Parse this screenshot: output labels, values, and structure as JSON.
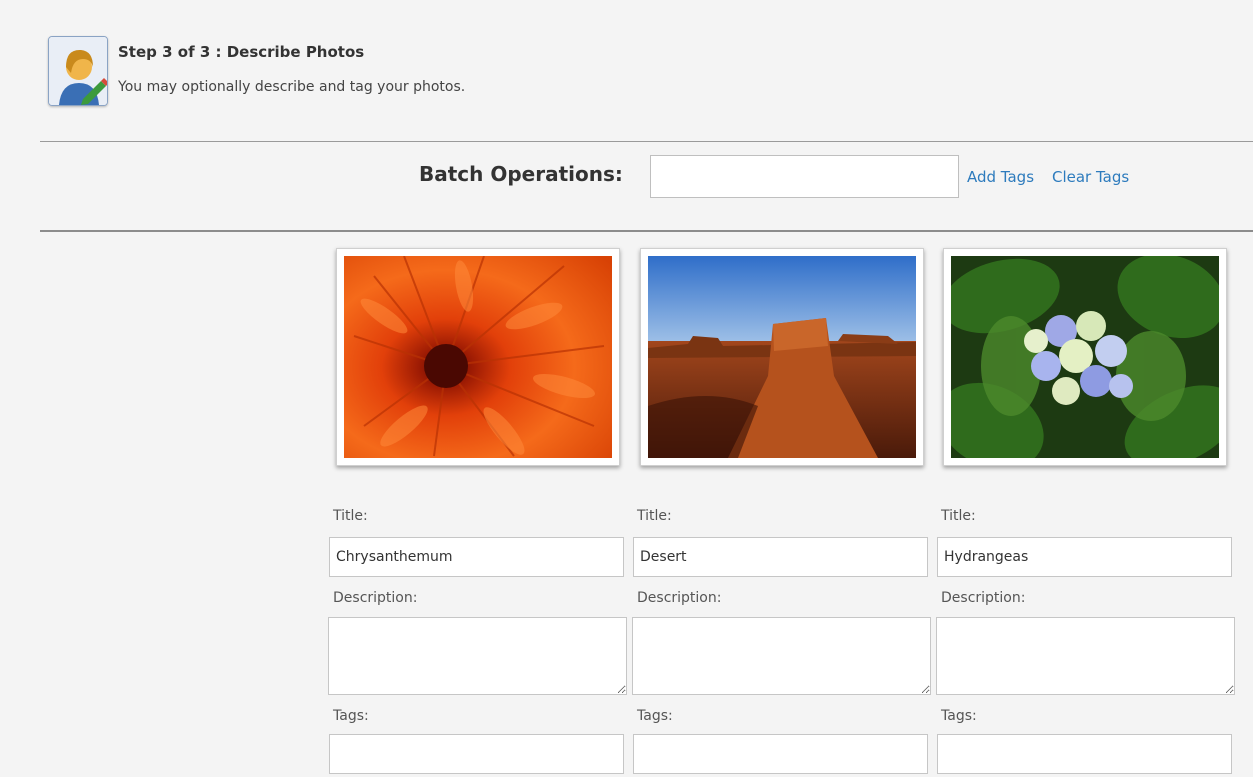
{
  "header": {
    "step_title": "Step 3 of 3 : Describe Photos",
    "step_subtitle": "You may optionally describe and tag your photos."
  },
  "batch": {
    "label": "Batch Operations:",
    "input_value": "",
    "add_tags_label": "Add Tags",
    "clear_tags_label": "Clear Tags"
  },
  "labels": {
    "title": "Title:",
    "description": "Description:",
    "tags": "Tags:"
  },
  "photos": [
    {
      "title": "Chrysanthemum",
      "description": "",
      "tags": "",
      "image": "chrysanthemum-photo"
    },
    {
      "title": "Desert",
      "description": "",
      "tags": "",
      "image": "desert-photo"
    },
    {
      "title": "Hydrangeas",
      "description": "",
      "tags": "",
      "image": "hydrangeas-photo"
    }
  ],
  "colors": {
    "background": "#f4f4f4",
    "link": "#2d7bbd",
    "rule": "#8c8c8c"
  }
}
